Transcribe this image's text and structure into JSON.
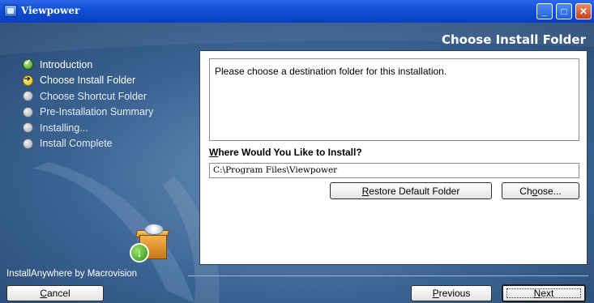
{
  "window": {
    "title": "Viewpower"
  },
  "header": {
    "step_title": "Choose Install Folder"
  },
  "steps": [
    {
      "label": "Introduction",
      "state": "done"
    },
    {
      "label": "Choose Install Folder",
      "state": "current"
    },
    {
      "label": "Choose Shortcut Folder",
      "state": "todo"
    },
    {
      "label": "Pre-Installation Summary",
      "state": "todo"
    },
    {
      "label": "Installing...",
      "state": "todo"
    },
    {
      "label": "Install Complete",
      "state": "todo"
    }
  ],
  "brand": "InstallAnywhere by Macrovision",
  "panel": {
    "message": "Please choose a destination folder for this installation.",
    "where_prefix": "W",
    "where_rest": "here Would You Like to Install?",
    "install_path": "C:\\Program Files\\Viewpower",
    "restore_accel": "R",
    "restore_rest": "estore Default Folder",
    "choose_pre": "Ch",
    "choose_accel": "o",
    "choose_post": "ose..."
  },
  "footer": {
    "cancel_accel": "C",
    "cancel_rest": "ancel",
    "prev_accel": "P",
    "prev_rest": "revious",
    "next_accel": "N",
    "next_rest": "ext"
  },
  "colors": {
    "titlebar": "#0f4fd6",
    "background": "#3c6493",
    "accent_close": "#c7401f"
  }
}
